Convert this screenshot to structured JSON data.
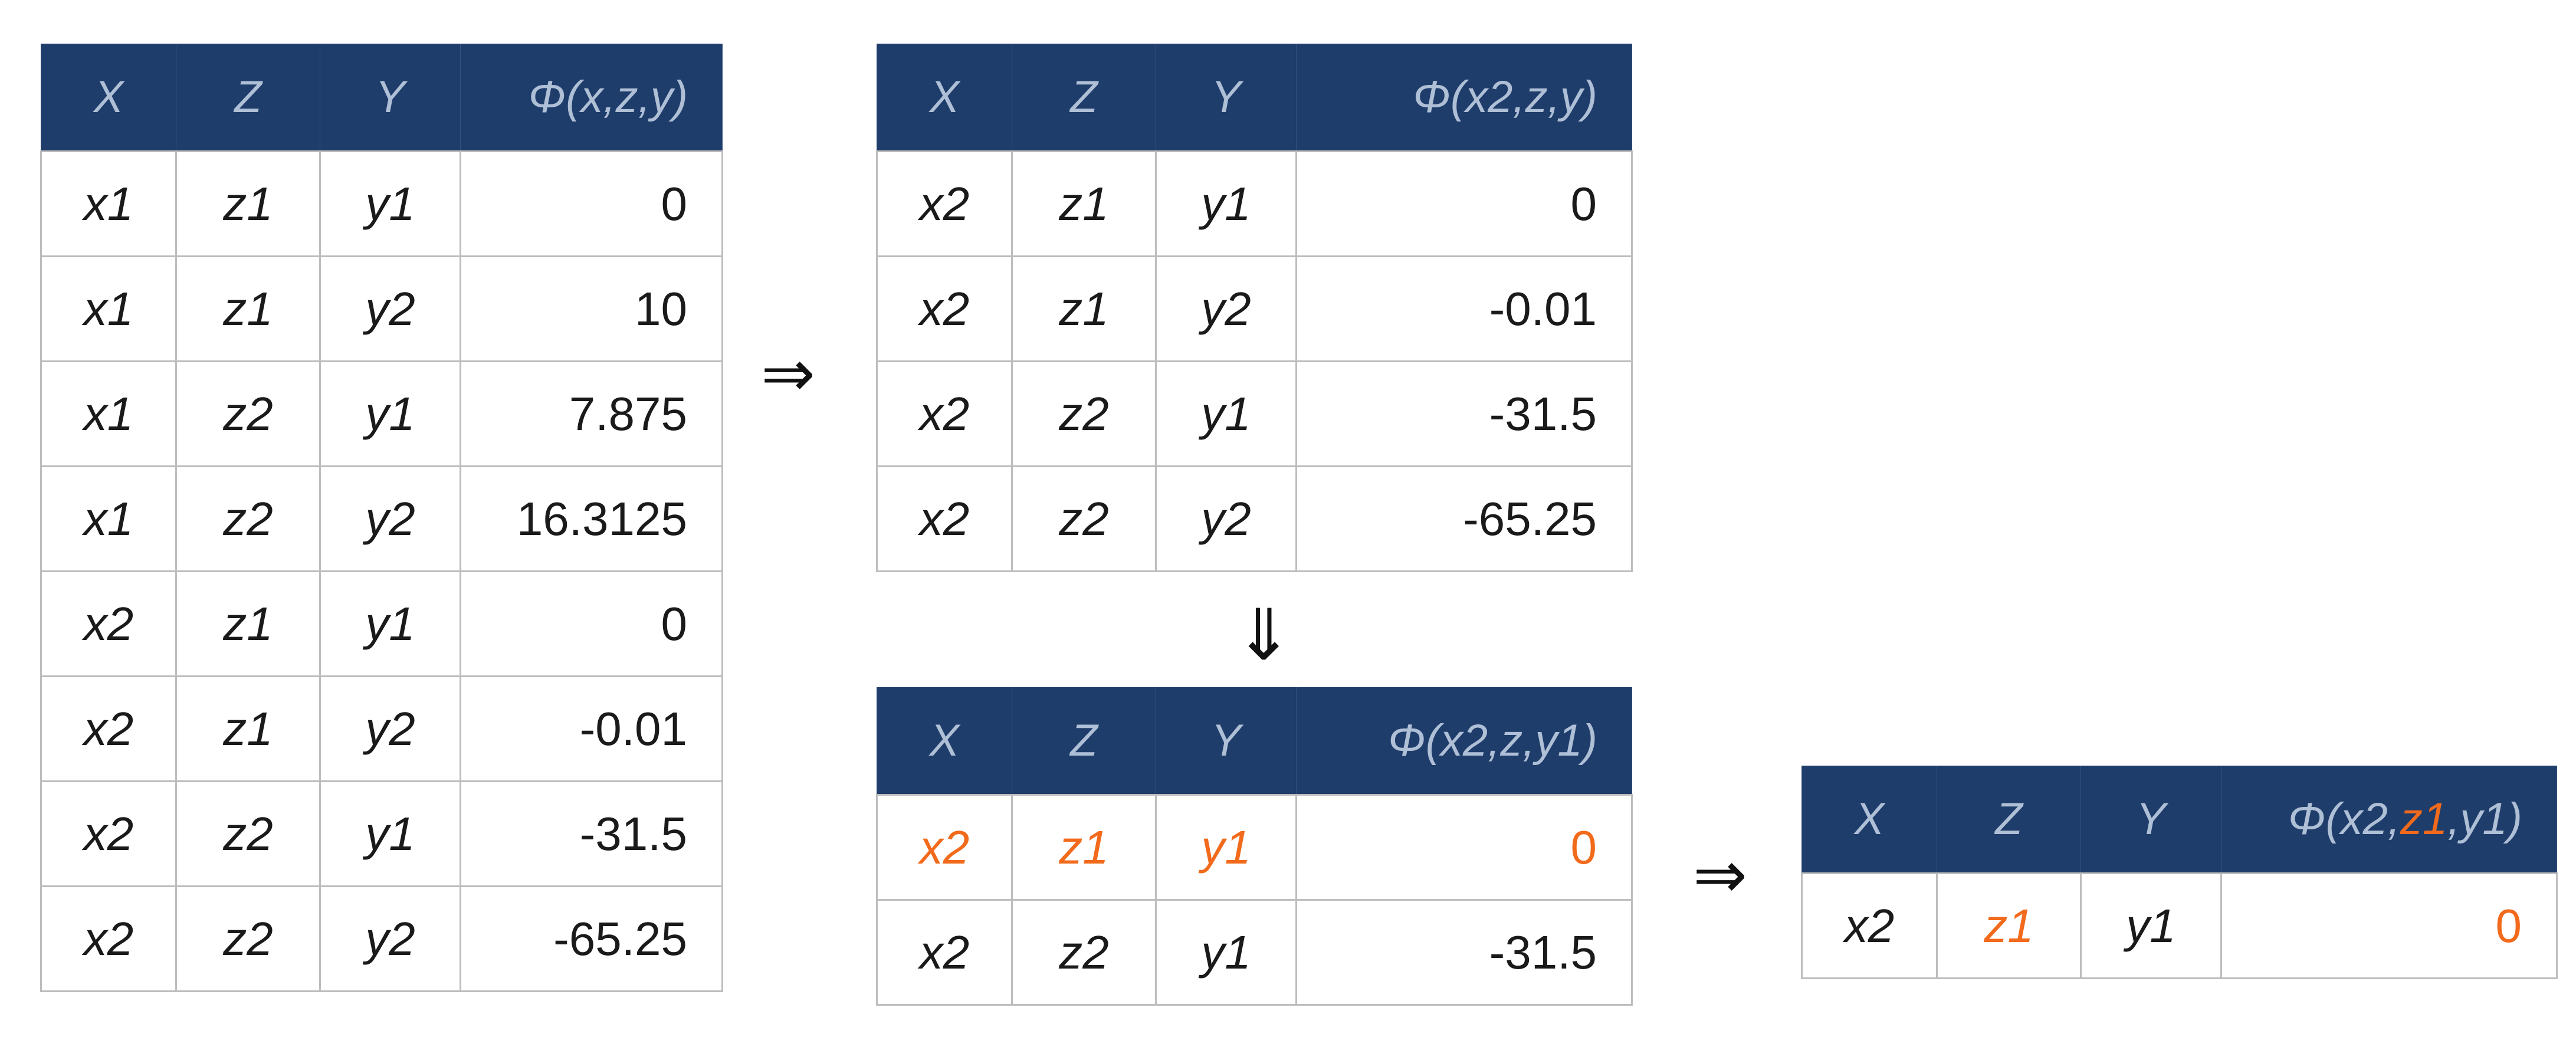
{
  "table1": {
    "headers": [
      "X",
      "Z",
      "Y",
      "Φ(x,z,y)"
    ],
    "rows": [
      [
        "x1",
        "z1",
        "y1",
        "0"
      ],
      [
        "x1",
        "z1",
        "y2",
        "10"
      ],
      [
        "x1",
        "z2",
        "y1",
        "7.875"
      ],
      [
        "x1",
        "z2",
        "y2",
        "16.3125"
      ],
      [
        "x2",
        "z1",
        "y1",
        "0"
      ],
      [
        "x2",
        "z1",
        "y2",
        "-0.01"
      ],
      [
        "x2",
        "z2",
        "y1",
        "-31.5"
      ],
      [
        "x2",
        "z2",
        "y2",
        "-65.25"
      ]
    ]
  },
  "table2": {
    "headers": [
      "X",
      "Z",
      "Y",
      "Φ(x2,z,y)"
    ],
    "rows": [
      [
        "x2",
        "z1",
        "y1",
        "0"
      ],
      [
        "x2",
        "z1",
        "y2",
        "-0.01"
      ],
      [
        "x2",
        "z2",
        "y1",
        "-31.5"
      ],
      [
        "x2",
        "z2",
        "y2",
        "-65.25"
      ]
    ]
  },
  "table3": {
    "headers": [
      "X",
      "Z",
      "Y",
      "Φ(x2,z,y1)"
    ],
    "rows": [
      [
        "x2",
        "z1",
        "y1",
        "0"
      ],
      [
        "x2",
        "z2",
        "y1",
        "-31.5"
      ]
    ],
    "highlight_row": 0
  },
  "table4": {
    "headers": [
      "X",
      "Z",
      "Y"
    ],
    "phi_header_parts": [
      "Φ(x2,",
      "z1",
      ",y1)"
    ],
    "rows": [
      [
        "x2",
        "z1",
        "y1",
        "0"
      ]
    ]
  },
  "arrows": {
    "right": "⇒",
    "down": "⇓"
  },
  "colors": {
    "header_bg": "#1f3d6b",
    "header_text": "#aebfd6",
    "highlight": "#f26a1b"
  }
}
